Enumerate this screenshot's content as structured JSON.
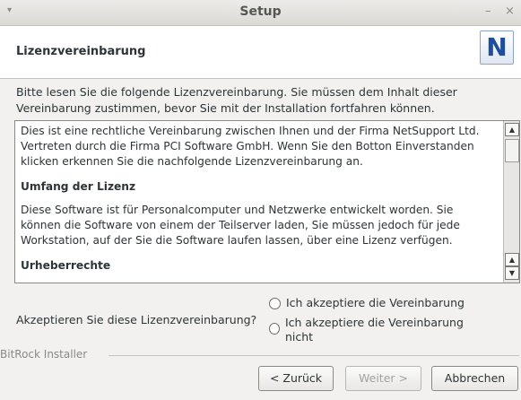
{
  "window": {
    "title": "Setup",
    "minimize": "–",
    "close": "×",
    "menu": "▾"
  },
  "header": {
    "title": "Lizenzvereinbarung",
    "logo_letter": "N"
  },
  "intro": "Bitte lesen Sie die folgende Lizenzvereinbarung. Sie müssen dem Inhalt dieser Vereinbarung zustimmen, bevor Sie mit der Installation fortfahren können.",
  "license": {
    "paragraph1": "Dies ist eine rechtliche Vereinbarung zwischen Ihnen und der Firma NetSupport Ltd. Vertreten durch die Firma PCI Software GmbH. Wenn Sie den Botton Einverstanden klicken erkennen Sie die nachfolgende Lizenzvereinbarung an.",
    "heading1": "Umfang der Lizenz",
    "paragraph2": "Diese Software ist für Personalcomputer und Netzwerke entwickelt worden. Sie können die Software von einem der Teilserver laden, Sie müssen jedoch für jede Workstation, auf der Sie die Software laufen lassen, über eine Lizenz verfügen.",
    "heading2": "Urheberrechte"
  },
  "question": "Akzeptieren Sie diese Lizenzvereinbarung?",
  "options": [
    {
      "label": "Ich akzeptiere die Vereinbarung",
      "selected": false
    },
    {
      "label": "Ich akzeptiere die Vereinbarung nicht",
      "selected": false
    }
  ],
  "installer": "BitRock Installer",
  "buttons": {
    "back": "< Zurück",
    "next": "Weiter >",
    "cancel": "Abbrechen"
  }
}
